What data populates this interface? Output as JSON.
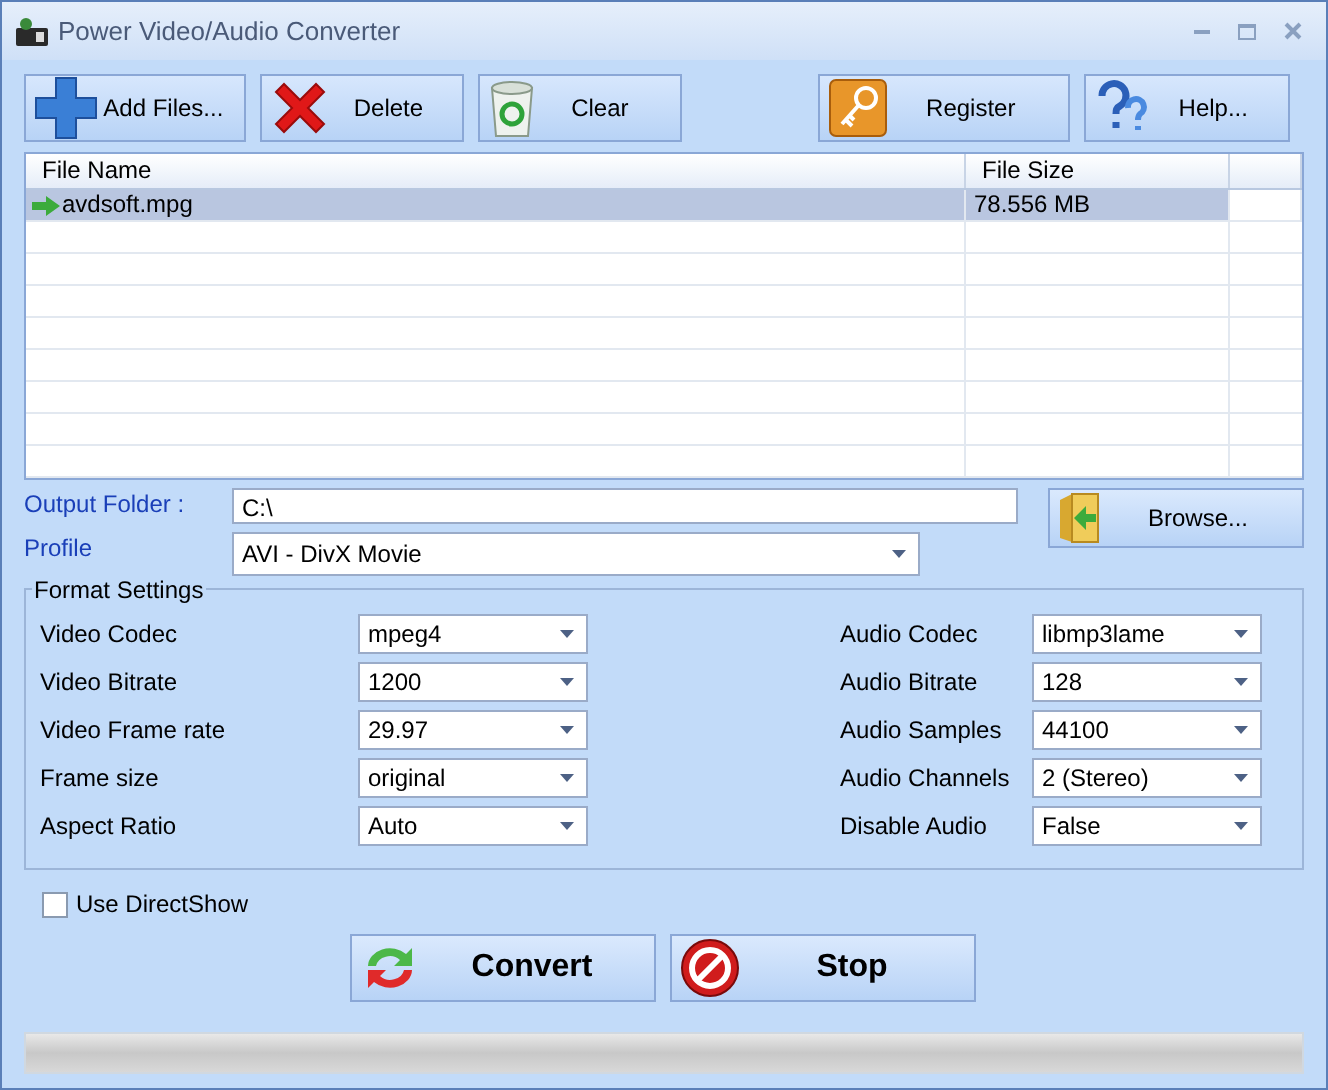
{
  "window": {
    "title": "Power Video/Audio Converter"
  },
  "toolbar": [
    {
      "kind": "add",
      "label": "Add Files..."
    },
    {
      "kind": "delete",
      "label": "Delete"
    },
    {
      "kind": "clear",
      "label": "Clear"
    },
    {
      "kind": "register",
      "label": "Register"
    },
    {
      "kind": "help",
      "label": "Help..."
    }
  ],
  "file_list": {
    "columns": [
      "File Name",
      "File Size"
    ],
    "rows": [
      {
        "name": "avdsoft.mpg",
        "size": "78.556 MB",
        "selected": true
      }
    ]
  },
  "output_folder": {
    "label": "Output Folder :",
    "value": "C:\\",
    "browse": "Browse..."
  },
  "profile": {
    "label": "Profile",
    "value": "AVI - DivX Movie"
  },
  "format_settings": {
    "title": "Format Settings",
    "left": [
      {
        "label": "Video Codec",
        "value": "mpeg4"
      },
      {
        "label": "Video Bitrate",
        "value": "1200"
      },
      {
        "label": "Video Frame rate",
        "value": "29.97"
      },
      {
        "label": "Frame size",
        "value": "original"
      },
      {
        "label": "Aspect Ratio",
        "value": "Auto"
      }
    ],
    "right": [
      {
        "label": "Audio Codec",
        "value": "libmp3lame"
      },
      {
        "label": "Audio Bitrate",
        "value": "128"
      },
      {
        "label": "Audio Samples",
        "value": "44100"
      },
      {
        "label": "Audio Channels",
        "value": "2 (Stereo)"
      },
      {
        "label": "Disable Audio",
        "value": "False"
      }
    ]
  },
  "use_directshow": {
    "label": "Use DirectShow",
    "checked": false
  },
  "actions": [
    {
      "kind": "convert",
      "label": "Convert"
    },
    {
      "kind": "stop",
      "label": "Stop"
    }
  ],
  "progress": {
    "level": 0
  }
}
